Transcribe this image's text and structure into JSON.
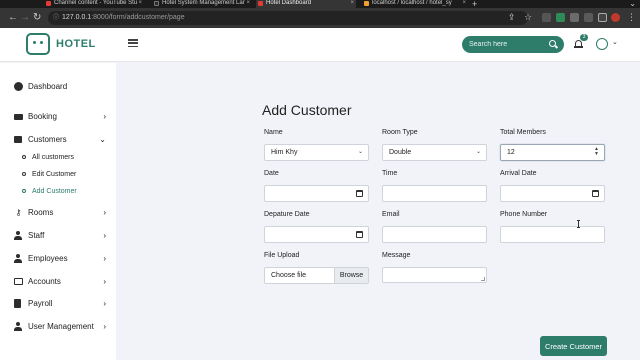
{
  "browser": {
    "tabs": [
      {
        "title": "Channel content - YouTube Stu",
        "favicon_color": "#e53935"
      },
      {
        "title": "Hotel System Management Lar",
        "favicon_color": "#2b2b2b"
      },
      {
        "title": "Hotel Dashboard",
        "favicon_color": "#e53935"
      },
      {
        "title": "localhost / localhost / hotel_sy",
        "favicon_color": "#f0a030"
      }
    ],
    "url_host": "127.0.0.1",
    "url_path": ":8000/form/addcustomer/page"
  },
  "app": {
    "brand": "HOTEL",
    "brand_color": "#2e7d6b",
    "search_placeholder": "Search here",
    "notification_count": "3"
  },
  "sidebar": {
    "dashboard": "Dashboard",
    "booking": "Booking",
    "customers": "Customers",
    "customer_sub": [
      "All customers",
      "Edit Customer",
      "Add Customer"
    ],
    "rooms": "Rooms",
    "staff": "Staff",
    "employees": "Employees",
    "accounts": "Accounts",
    "payroll": "Payroll",
    "user_management": "User Management"
  },
  "form": {
    "title": "Add Customer",
    "name_label": "Name",
    "name_value": "Him Khy",
    "room_type_label": "Room Type",
    "room_type_value": "Double",
    "total_members_label": "Total Members",
    "total_members_value": "12",
    "date_label": "Date",
    "time_label": "Time",
    "arrival_date_label": "Arrival Date",
    "departure_date_label": "Depature Date",
    "email_label": "Email",
    "phone_label": "Phone Number",
    "file_upload_label": "File Upload",
    "choose_file": "Choose file",
    "browse": "Browse",
    "message_label": "Message",
    "submit": "Create Customer"
  }
}
